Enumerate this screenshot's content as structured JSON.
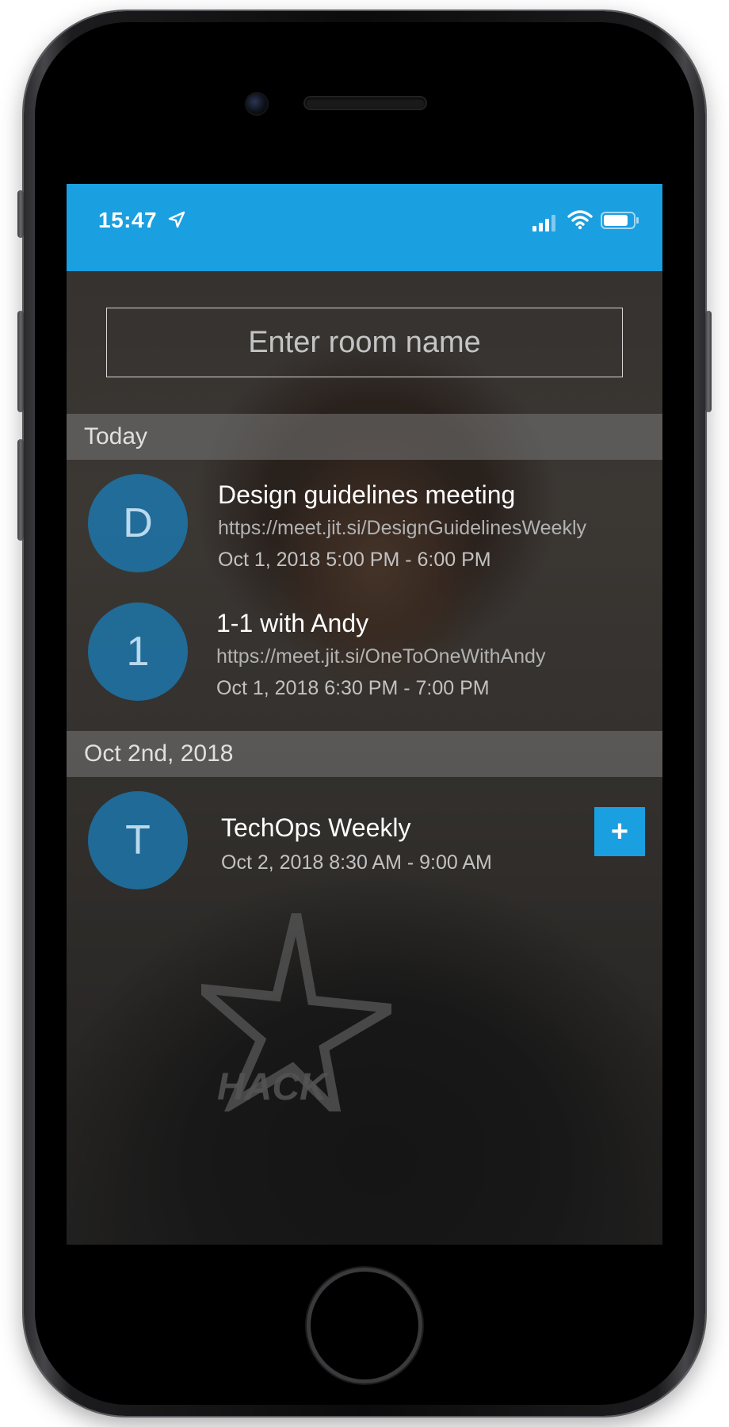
{
  "status_bar": {
    "time": "15:47",
    "color": "#1a9fe0"
  },
  "room_input": {
    "placeholder": "Enter room name",
    "value": ""
  },
  "sections": [
    {
      "header": "Today",
      "events": [
        {
          "avatar_letter": "D",
          "title": "Design guidelines meeting",
          "url": "https://meet.jit.si/DesignGuidelinesWeekly",
          "time": "Oct 1, 2018 5:00 PM - 6:00 PM"
        },
        {
          "avatar_letter": "1",
          "title": "1-1 with Andy",
          "url": "https://meet.jit.si/OneToOneWithAndy",
          "time": "Oct 1, 2018 6:30 PM - 7:00 PM"
        }
      ]
    },
    {
      "header": "Oct 2nd, 2018",
      "events": [
        {
          "avatar_letter": "T",
          "title": "TechOps Weekly",
          "time": "Oct 2, 2018 8:30 AM - 9:00 AM",
          "add_button_label": "+"
        }
      ]
    }
  ],
  "background_shirt_text": "HACK",
  "icons": {
    "location": "location-arrow-icon",
    "signal": "cellular-signal-icon",
    "wifi": "wifi-icon",
    "battery": "battery-icon",
    "add": "plus-icon"
  }
}
